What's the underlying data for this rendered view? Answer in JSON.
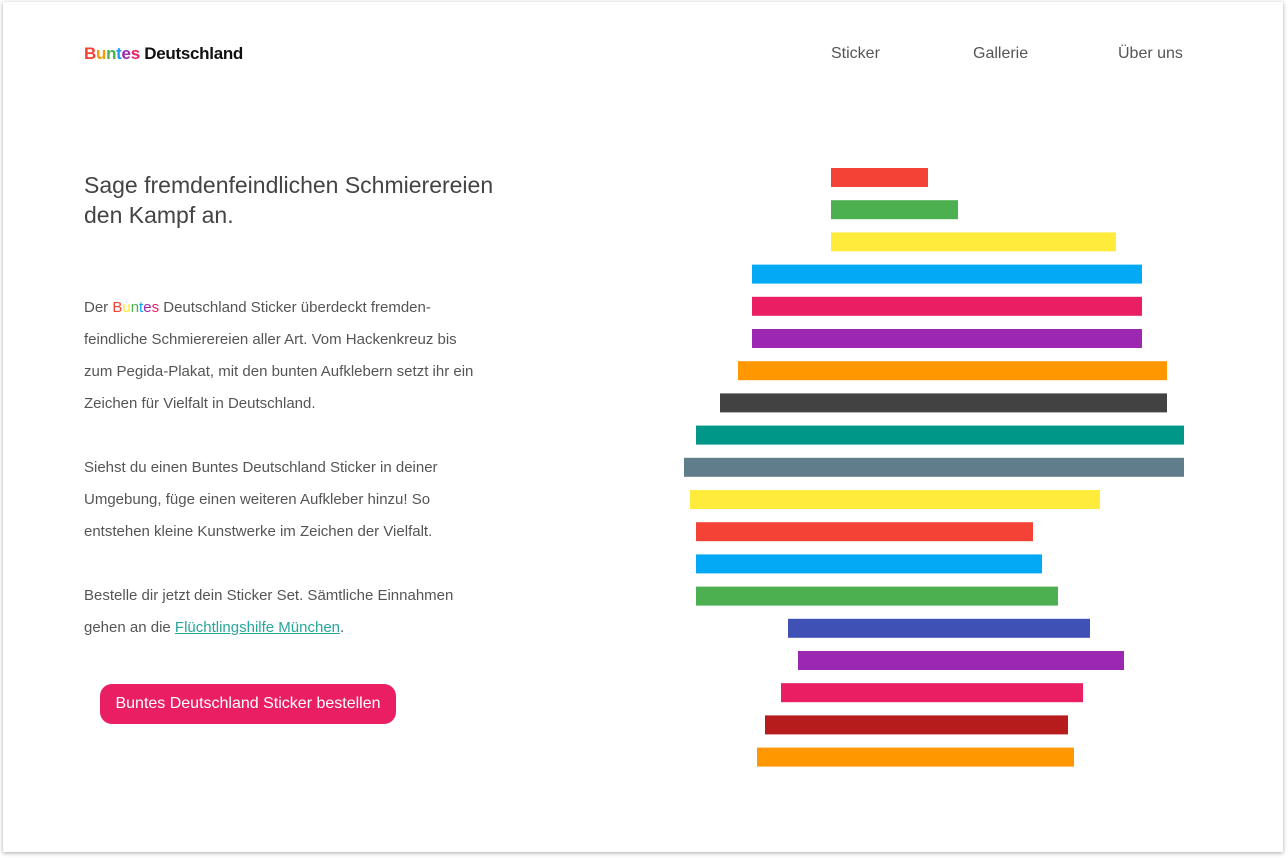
{
  "header": {
    "logo_word1_letters": [
      {
        "char": "B",
        "color": "#f44336"
      },
      {
        "char": "u",
        "color": "#ff9800"
      },
      {
        "char": "n",
        "color": "#4caf50"
      },
      {
        "char": "t",
        "color": "#2196f3"
      },
      {
        "char": "e",
        "color": "#9c27b0"
      },
      {
        "char": "s",
        "color": "#e91e63"
      }
    ],
    "logo_word2": "Deutschland",
    "nav": {
      "sticker": "Sticker",
      "gallery": "Gallerie",
      "about": "Über uns"
    }
  },
  "main": {
    "headline": "Sage fremdenfeindlichen Schmierereien den Kampf an.",
    "para1_prefix": "Der ",
    "para1_brand_letters": [
      {
        "char": "B",
        "color": "#f44336"
      },
      {
        "char": "u",
        "color": "#ffeb3b"
      },
      {
        "char": "n",
        "color": "#4caf50"
      },
      {
        "char": "t",
        "color": "#03a9f4"
      },
      {
        "char": "e",
        "color": "#9c27b0"
      },
      {
        "char": "s",
        "color": "#e91e63"
      }
    ],
    "para1_rest": " Deutschland Sticker überdeckt fremden-feindliche Schmierereien aller Art. Vom Hackenkreuz bis zum Pegida-Plakat, mit den bunten Aufklebern setzt ihr ein Zeichen für Vielfalt in Deutschland.",
    "para2": "Siehst du einen Buntes Deutschland Sticker in deiner Umgebung, füge einen weiteren Aufkleber hinzu! So entstehen kleine Kunstwerke im Zeichen der Vielfalt.",
    "para3_prefix": "Bestelle dir jetzt dein Sticker Set. Sämtliche Einnahmen gehen an die ",
    "para3_link": "Flüchtlingshilfe München",
    "para3_suffix": ".",
    "cta_label": "Buntes Deutschland Sticker bestellen"
  },
  "illustration": {
    "name": "Germany map made of colored sticker stripes",
    "stripes": [
      {
        "color": "#f44336"
      },
      {
        "color": "#4caf50"
      },
      {
        "color": "#ffeb3b"
      },
      {
        "color": "#03a9f4"
      },
      {
        "color": "#e91e63"
      },
      {
        "color": "#9c27b0"
      },
      {
        "color": "#ff9800"
      },
      {
        "color": "#424242"
      },
      {
        "color": "#009688"
      },
      {
        "color": "#607d8b"
      },
      {
        "color": "#ffeb3b"
      },
      {
        "color": "#f44336"
      },
      {
        "color": "#03a9f4"
      },
      {
        "color": "#4caf50"
      },
      {
        "color": "#3f51b5"
      },
      {
        "color": "#9c27b0"
      },
      {
        "color": "#e91e63"
      },
      {
        "color": "#b71c1c"
      },
      {
        "color": "#ff9800"
      }
    ]
  },
  "colors": {
    "accent": "#e91e63",
    "link": "#26a69a",
    "text": "#555555"
  }
}
